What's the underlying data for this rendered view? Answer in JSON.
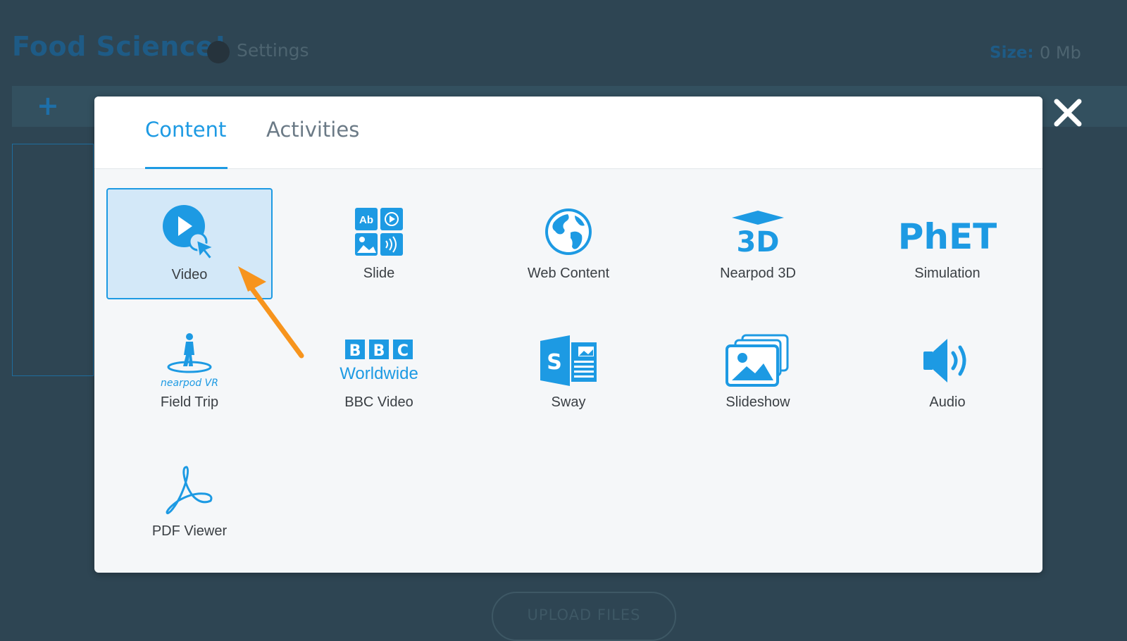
{
  "background": {
    "title": "Food Science!",
    "settings_label": "Settings",
    "size_label": "Size:",
    "size_value": "0 Mb",
    "upload_label": "UPLOAD FILES",
    "add_icon": "plus-icon"
  },
  "modal": {
    "tabs": [
      {
        "label": "Content",
        "active": true
      },
      {
        "label": "Activities",
        "active": false
      }
    ],
    "items": [
      {
        "label": "Video",
        "icon": "video-play-cursor-icon",
        "selected": true
      },
      {
        "label": "Slide",
        "icon": "slide-grid-icon"
      },
      {
        "label": "Web Content",
        "icon": "globe-icon"
      },
      {
        "label": "Nearpod 3D",
        "icon": "nearpod-3d-icon"
      },
      {
        "label": "Simulation",
        "icon": "phet-logo",
        "logo_text": "PhET"
      },
      {
        "label": "Field Trip",
        "icon": "nearpod-vr-icon",
        "logo_text": "nearpod VR"
      },
      {
        "label": "BBC Video",
        "icon": "bbc-worldwide-logo",
        "logo_text": "BBC Worldwide"
      },
      {
        "label": "Sway",
        "icon": "sway-icon"
      },
      {
        "label": "Slideshow",
        "icon": "slideshow-icon"
      },
      {
        "label": "Audio",
        "icon": "speaker-icon"
      },
      {
        "label": "PDF Viewer",
        "icon": "pdf-icon"
      }
    ],
    "close_icon": "close-icon"
  },
  "annotation": {
    "icon": "pointer-arrow",
    "color": "#f7941d"
  },
  "colors": {
    "accent": "#1d9ae3",
    "selected_bg": "#d3e8f8",
    "overlay": "#2e4553",
    "label": "#3a3f44"
  }
}
